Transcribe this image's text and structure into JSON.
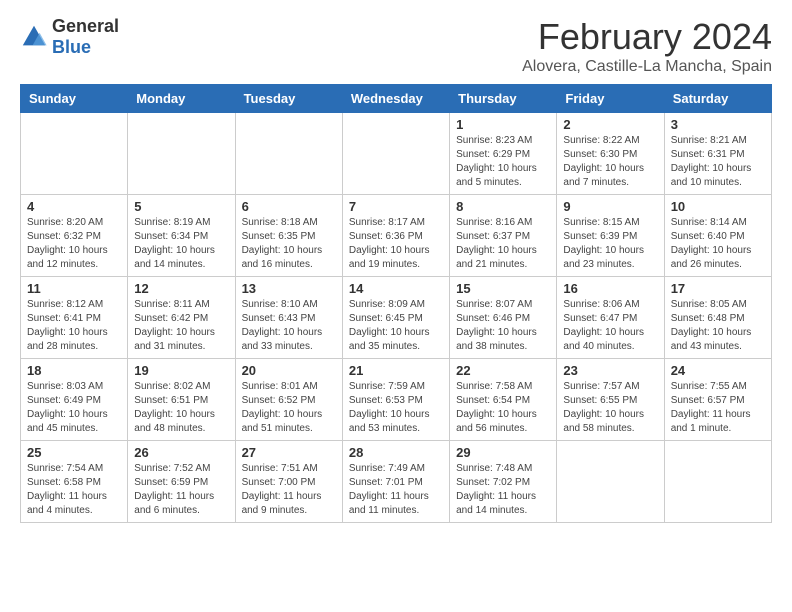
{
  "header": {
    "logo": {
      "general": "General",
      "blue": "Blue"
    },
    "title": "February 2024",
    "subtitle": "Alovera, Castille-La Mancha, Spain"
  },
  "columns": [
    "Sunday",
    "Monday",
    "Tuesday",
    "Wednesday",
    "Thursday",
    "Friday",
    "Saturday"
  ],
  "weeks": [
    [
      {
        "day": "",
        "info": ""
      },
      {
        "day": "",
        "info": ""
      },
      {
        "day": "",
        "info": ""
      },
      {
        "day": "",
        "info": ""
      },
      {
        "day": "1",
        "info": "Sunrise: 8:23 AM\nSunset: 6:29 PM\nDaylight: 10 hours\nand 5 minutes."
      },
      {
        "day": "2",
        "info": "Sunrise: 8:22 AM\nSunset: 6:30 PM\nDaylight: 10 hours\nand 7 minutes."
      },
      {
        "day": "3",
        "info": "Sunrise: 8:21 AM\nSunset: 6:31 PM\nDaylight: 10 hours\nand 10 minutes."
      }
    ],
    [
      {
        "day": "4",
        "info": "Sunrise: 8:20 AM\nSunset: 6:32 PM\nDaylight: 10 hours\nand 12 minutes."
      },
      {
        "day": "5",
        "info": "Sunrise: 8:19 AM\nSunset: 6:34 PM\nDaylight: 10 hours\nand 14 minutes."
      },
      {
        "day": "6",
        "info": "Sunrise: 8:18 AM\nSunset: 6:35 PM\nDaylight: 10 hours\nand 16 minutes."
      },
      {
        "day": "7",
        "info": "Sunrise: 8:17 AM\nSunset: 6:36 PM\nDaylight: 10 hours\nand 19 minutes."
      },
      {
        "day": "8",
        "info": "Sunrise: 8:16 AM\nSunset: 6:37 PM\nDaylight: 10 hours\nand 21 minutes."
      },
      {
        "day": "9",
        "info": "Sunrise: 8:15 AM\nSunset: 6:39 PM\nDaylight: 10 hours\nand 23 minutes."
      },
      {
        "day": "10",
        "info": "Sunrise: 8:14 AM\nSunset: 6:40 PM\nDaylight: 10 hours\nand 26 minutes."
      }
    ],
    [
      {
        "day": "11",
        "info": "Sunrise: 8:12 AM\nSunset: 6:41 PM\nDaylight: 10 hours\nand 28 minutes."
      },
      {
        "day": "12",
        "info": "Sunrise: 8:11 AM\nSunset: 6:42 PM\nDaylight: 10 hours\nand 31 minutes."
      },
      {
        "day": "13",
        "info": "Sunrise: 8:10 AM\nSunset: 6:43 PM\nDaylight: 10 hours\nand 33 minutes."
      },
      {
        "day": "14",
        "info": "Sunrise: 8:09 AM\nSunset: 6:45 PM\nDaylight: 10 hours\nand 35 minutes."
      },
      {
        "day": "15",
        "info": "Sunrise: 8:07 AM\nSunset: 6:46 PM\nDaylight: 10 hours\nand 38 minutes."
      },
      {
        "day": "16",
        "info": "Sunrise: 8:06 AM\nSunset: 6:47 PM\nDaylight: 10 hours\nand 40 minutes."
      },
      {
        "day": "17",
        "info": "Sunrise: 8:05 AM\nSunset: 6:48 PM\nDaylight: 10 hours\nand 43 minutes."
      }
    ],
    [
      {
        "day": "18",
        "info": "Sunrise: 8:03 AM\nSunset: 6:49 PM\nDaylight: 10 hours\nand 45 minutes."
      },
      {
        "day": "19",
        "info": "Sunrise: 8:02 AM\nSunset: 6:51 PM\nDaylight: 10 hours\nand 48 minutes."
      },
      {
        "day": "20",
        "info": "Sunrise: 8:01 AM\nSunset: 6:52 PM\nDaylight: 10 hours\nand 51 minutes."
      },
      {
        "day": "21",
        "info": "Sunrise: 7:59 AM\nSunset: 6:53 PM\nDaylight: 10 hours\nand 53 minutes."
      },
      {
        "day": "22",
        "info": "Sunrise: 7:58 AM\nSunset: 6:54 PM\nDaylight: 10 hours\nand 56 minutes."
      },
      {
        "day": "23",
        "info": "Sunrise: 7:57 AM\nSunset: 6:55 PM\nDaylight: 10 hours\nand 58 minutes."
      },
      {
        "day": "24",
        "info": "Sunrise: 7:55 AM\nSunset: 6:57 PM\nDaylight: 11 hours\nand 1 minute."
      }
    ],
    [
      {
        "day": "25",
        "info": "Sunrise: 7:54 AM\nSunset: 6:58 PM\nDaylight: 11 hours\nand 4 minutes."
      },
      {
        "day": "26",
        "info": "Sunrise: 7:52 AM\nSunset: 6:59 PM\nDaylight: 11 hours\nand 6 minutes."
      },
      {
        "day": "27",
        "info": "Sunrise: 7:51 AM\nSunset: 7:00 PM\nDaylight: 11 hours\nand 9 minutes."
      },
      {
        "day": "28",
        "info": "Sunrise: 7:49 AM\nSunset: 7:01 PM\nDaylight: 11 hours\nand 11 minutes."
      },
      {
        "day": "29",
        "info": "Sunrise: 7:48 AM\nSunset: 7:02 PM\nDaylight: 11 hours\nand 14 minutes."
      },
      {
        "day": "",
        "info": ""
      },
      {
        "day": "",
        "info": ""
      }
    ]
  ]
}
